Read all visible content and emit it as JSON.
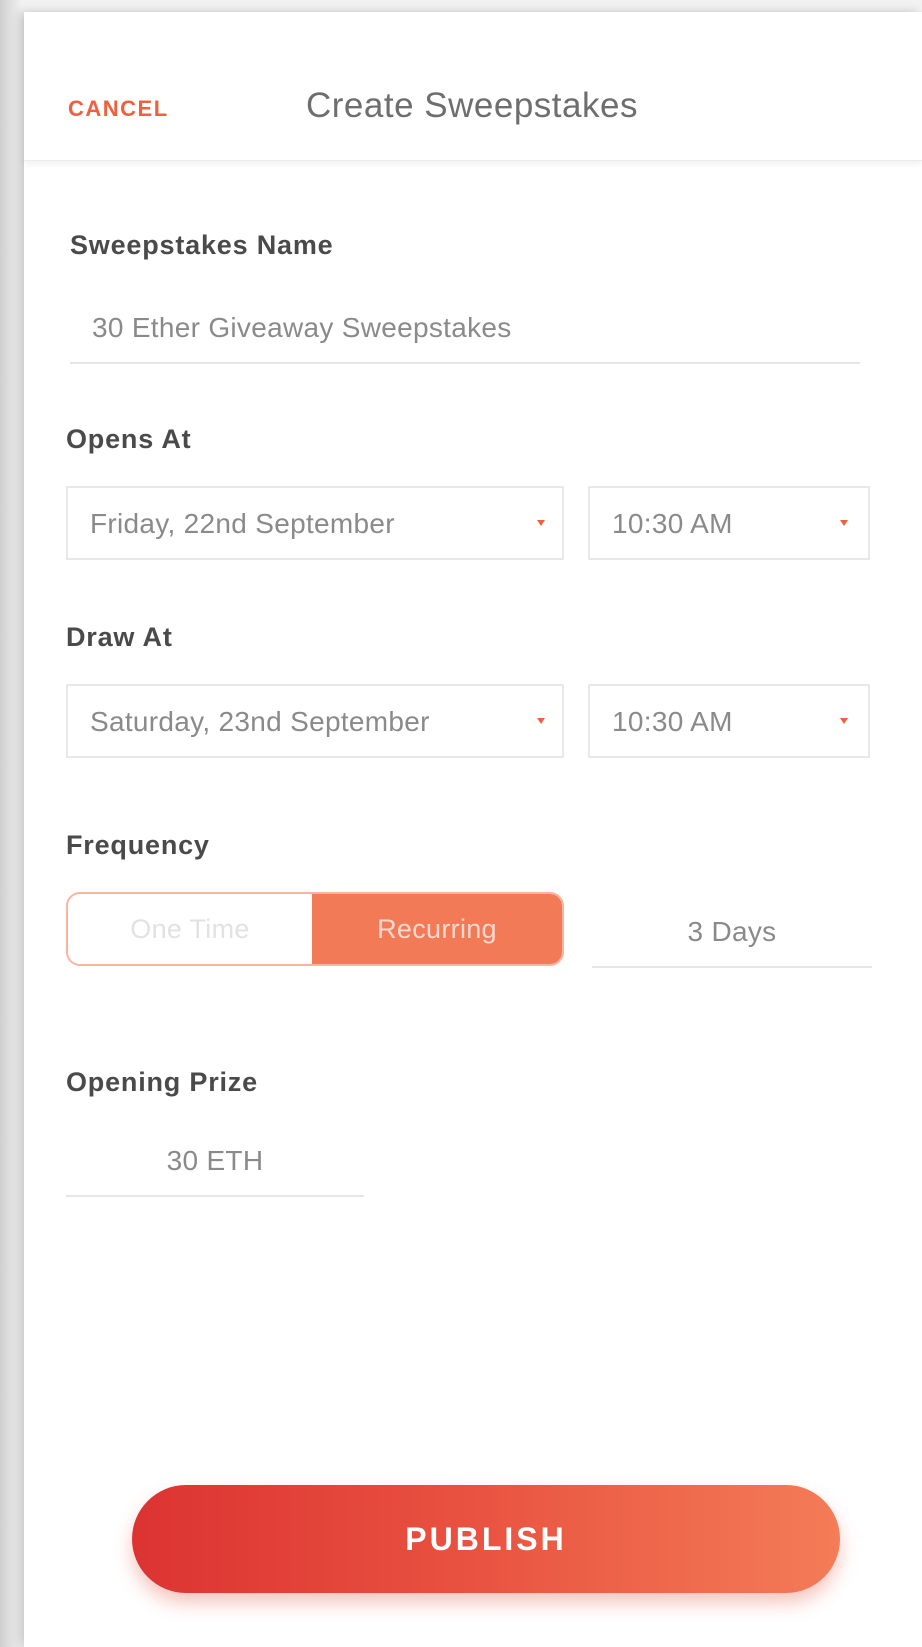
{
  "header": {
    "cancel_label": "CANCEL",
    "title": "Create Sweepstakes"
  },
  "form": {
    "name": {
      "label": "Sweepstakes Name",
      "value": "30 Ether Giveaway Sweepstakes"
    },
    "opens_at": {
      "label": "Opens At",
      "date": "Friday, 22nd September",
      "time": "10:30 AM"
    },
    "draw_at": {
      "label": "Draw At",
      "date": "Saturday, 23nd September",
      "time": "10:30 AM"
    },
    "frequency": {
      "label": "Frequency",
      "options": [
        "One Time",
        "Recurring"
      ],
      "selected": "Recurring",
      "interval": "3 Days"
    },
    "opening_prize": {
      "label": "Opening Prize",
      "value": "30 ETH"
    }
  },
  "actions": {
    "publish_label": "PUBLISH"
  },
  "colors": {
    "accent": "#f0603f",
    "segment_active": "#f37a57",
    "gradient_start": "#dc3332",
    "gradient_end": "#f47c57"
  }
}
